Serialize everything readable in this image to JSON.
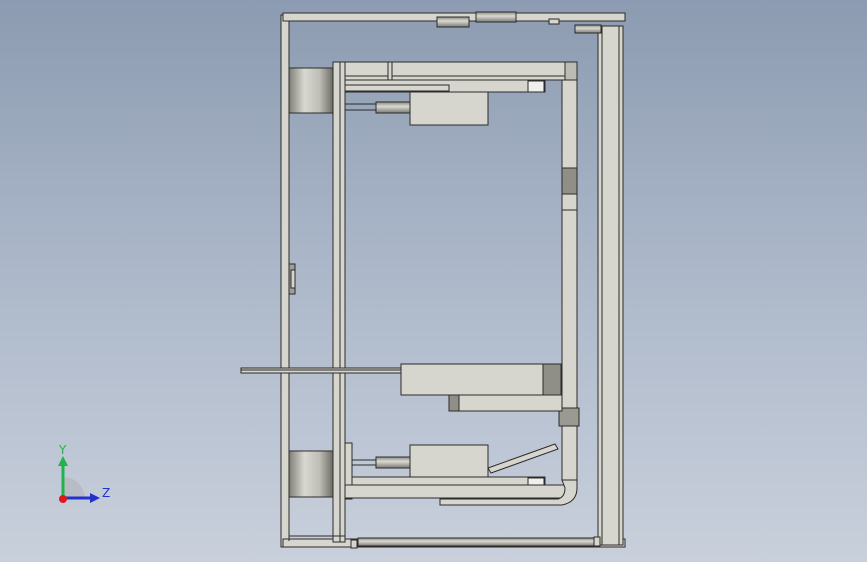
{
  "viewport": {
    "background_top": "#8c9bb1",
    "background_bottom": "#c9d0dc"
  },
  "model": {
    "part_fill": "#d6d6ce",
    "part_stroke": "#2b2b2b",
    "shadow_fill": "#8f8f88"
  },
  "triad": {
    "y_label": "Y",
    "z_label": "Z",
    "y_color": "#22b24c",
    "z_color": "#2233cc",
    "x_color": "#e01818"
  }
}
